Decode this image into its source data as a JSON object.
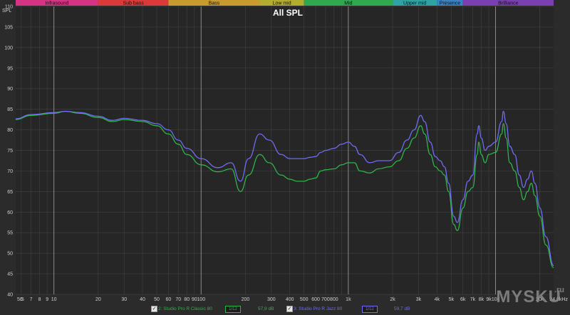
{
  "chart_data": {
    "type": "line",
    "title": "All SPL",
    "ylabel": "SPL",
    "xscale": "log",
    "xlim": [
      5.5,
      24800
    ],
    "ylim": [
      40,
      110
    ],
    "grid": true,
    "bands": [
      {
        "name": "Infrasound",
        "from": 5.5,
        "to": 20,
        "color": "#d63384"
      },
      {
        "name": "Sub bass",
        "from": 20,
        "to": 60,
        "color": "#dc3a3a"
      },
      {
        "name": "Bass",
        "from": 60,
        "to": 250,
        "color": "#c99a2e"
      },
      {
        "name": "Low mid",
        "from": 250,
        "to": 500,
        "color": "#b3ad2f"
      },
      {
        "name": "Mid",
        "from": 500,
        "to": 2000,
        "color": "#2fa84f"
      },
      {
        "name": "Upper mid",
        "from": 2000,
        "to": 4000,
        "color": "#2fa3a3"
      },
      {
        "name": "Presence",
        "from": 4000,
        "to": 6000,
        "color": "#3b82c4"
      },
      {
        "name": "Brilliance",
        "from": 6000,
        "to": 24800,
        "color": "#7a3fb0"
      }
    ],
    "y_ticks": [
      "40",
      "45",
      "50",
      "55",
      "60",
      "65",
      "70",
      "75",
      "80",
      "85",
      "90",
      "95",
      "100",
      "105",
      "110"
    ],
    "x_ticks": [
      {
        "v": 5.5,
        "l": "5.5"
      },
      {
        "v": 6,
        "l": "6"
      },
      {
        "v": 7,
        "l": "7"
      },
      {
        "v": 8,
        "l": "8"
      },
      {
        "v": 9,
        "l": "9"
      },
      {
        "v": 10,
        "l": "10"
      },
      {
        "v": 20,
        "l": "20"
      },
      {
        "v": 30,
        "l": "30"
      },
      {
        "v": 40,
        "l": "40"
      },
      {
        "v": 50,
        "l": "50"
      },
      {
        "v": 60,
        "l": "60"
      },
      {
        "v": 70,
        "l": "70"
      },
      {
        "v": 80,
        "l": "80"
      },
      {
        "v": 90,
        "l": "90"
      },
      {
        "v": 100,
        "l": "100"
      },
      {
        "v": 200,
        "l": "200"
      },
      {
        "v": 300,
        "l": "300"
      },
      {
        "v": 400,
        "l": "400"
      },
      {
        "v": 500,
        "l": "500"
      },
      {
        "v": 600,
        "l": "600"
      },
      {
        "v": 700,
        "l": "700"
      },
      {
        "v": 800,
        "l": "800"
      },
      {
        "v": 1000,
        "l": "1k"
      },
      {
        "v": 2000,
        "l": "2k"
      },
      {
        "v": 3000,
        "l": "3k"
      },
      {
        "v": 4000,
        "l": "4k"
      },
      {
        "v": 5000,
        "l": "5k"
      },
      {
        "v": 6000,
        "l": "6k"
      },
      {
        "v": 7000,
        "l": "7k"
      },
      {
        "v": 8000,
        "l": "8k"
      },
      {
        "v": 9000,
        "l": "9k"
      },
      {
        "v": 10000,
        "l": "10k"
      },
      {
        "v": 20000,
        "l": "20k"
      },
      {
        "v": 24800,
        "l": "24.8kHz"
      }
    ],
    "series": [
      {
        "name": "2: Studio Pro R Classic 80",
        "color": "#2fb34a",
        "points": [
          [
            5.5,
            82.5
          ],
          [
            7,
            83.5
          ],
          [
            10,
            84
          ],
          [
            12,
            84.5
          ],
          [
            15,
            84
          ],
          [
            20,
            83
          ],
          [
            25,
            82
          ],
          [
            30,
            82.5
          ],
          [
            40,
            82
          ],
          [
            50,
            81
          ],
          [
            60,
            79
          ],
          [
            70,
            76.5
          ],
          [
            80,
            74
          ],
          [
            100,
            71.5
          ],
          [
            130,
            69.8
          ],
          [
            160,
            70.5
          ],
          [
            185,
            65
          ],
          [
            210,
            69
          ],
          [
            250,
            74
          ],
          [
            290,
            72
          ],
          [
            350,
            69
          ],
          [
            400,
            68
          ],
          [
            450,
            67.5
          ],
          [
            500,
            67.5
          ],
          [
            550,
            68
          ],
          [
            600,
            68.3
          ],
          [
            650,
            70
          ],
          [
            700,
            70.3
          ],
          [
            800,
            70.5
          ],
          [
            900,
            71.5
          ],
          [
            1000,
            72
          ],
          [
            1100,
            72
          ],
          [
            1200,
            70
          ],
          [
            1400,
            69.5
          ],
          [
            1600,
            70.5
          ],
          [
            1900,
            71
          ],
          [
            2200,
            72.5
          ],
          [
            2500,
            75.5
          ],
          [
            2800,
            78
          ],
          [
            3100,
            81
          ],
          [
            3300,
            79
          ],
          [
            3600,
            74
          ],
          [
            3900,
            71
          ],
          [
            4200,
            70
          ],
          [
            4500,
            69
          ],
          [
            4800,
            65
          ],
          [
            5200,
            57
          ],
          [
            5500,
            55.5
          ],
          [
            6000,
            61
          ],
          [
            6500,
            65
          ],
          [
            7000,
            66
          ],
          [
            7500,
            74
          ],
          [
            7700,
            77
          ],
          [
            8000,
            74
          ],
          [
            8500,
            72
          ],
          [
            9000,
            74
          ],
          [
            10000,
            74.5
          ],
          [
            11000,
            79
          ],
          [
            11300,
            81.5
          ],
          [
            11800,
            78
          ],
          [
            12500,
            72
          ],
          [
            13500,
            70
          ],
          [
            14500,
            66
          ],
          [
            15500,
            63
          ],
          [
            16500,
            65
          ],
          [
            17500,
            67
          ],
          [
            18500,
            64
          ],
          [
            20000,
            59
          ],
          [
            22000,
            52
          ],
          [
            24800,
            46.5
          ]
        ]
      },
      {
        "name": "3: Studio Pro R Jazz 80",
        "color": "#6f6cf2",
        "points": [
          [
            5.5,
            82.7
          ],
          [
            7,
            83.7
          ],
          [
            10,
            84.2
          ],
          [
            12,
            84.5
          ],
          [
            15,
            84.2
          ],
          [
            20,
            83.3
          ],
          [
            25,
            82.3
          ],
          [
            30,
            82.8
          ],
          [
            40,
            82.3
          ],
          [
            50,
            81.5
          ],
          [
            60,
            80
          ],
          [
            70,
            77.5
          ],
          [
            80,
            75.5
          ],
          [
            100,
            73
          ],
          [
            130,
            70.8
          ],
          [
            160,
            72
          ],
          [
            185,
            67.5
          ],
          [
            210,
            73
          ],
          [
            250,
            79
          ],
          [
            290,
            77.5
          ],
          [
            350,
            74
          ],
          [
            400,
            73
          ],
          [
            450,
            73
          ],
          [
            500,
            73
          ],
          [
            550,
            73.3
          ],
          [
            600,
            73.5
          ],
          [
            650,
            74.5
          ],
          [
            700,
            75
          ],
          [
            800,
            75.5
          ],
          [
            900,
            76.5
          ],
          [
            1000,
            77
          ],
          [
            1100,
            76
          ],
          [
            1200,
            74
          ],
          [
            1400,
            72
          ],
          [
            1600,
            72.5
          ],
          [
            1900,
            72.5
          ],
          [
            2200,
            74.5
          ],
          [
            2500,
            77.5
          ],
          [
            2800,
            80
          ],
          [
            3100,
            83.5
          ],
          [
            3300,
            82
          ],
          [
            3600,
            77
          ],
          [
            3900,
            73.5
          ],
          [
            4200,
            72.5
          ],
          [
            4500,
            71
          ],
          [
            4800,
            67
          ],
          [
            5200,
            59
          ],
          [
            5500,
            57.5
          ],
          [
            6000,
            63
          ],
          [
            6500,
            67.5
          ],
          [
            7000,
            69
          ],
          [
            7500,
            79
          ],
          [
            7700,
            81
          ],
          [
            8000,
            78
          ],
          [
            8500,
            75
          ],
          [
            9000,
            76
          ],
          [
            10000,
            77
          ],
          [
            11000,
            82
          ],
          [
            11300,
            84.5
          ],
          [
            11800,
            81.5
          ],
          [
            12500,
            76
          ],
          [
            13500,
            74
          ],
          [
            14500,
            69
          ],
          [
            15500,
            66
          ],
          [
            16500,
            68
          ],
          [
            17500,
            70
          ],
          [
            18500,
            67
          ],
          [
            20000,
            61
          ],
          [
            22000,
            54
          ],
          [
            24800,
            47
          ]
        ]
      }
    ]
  },
  "legend": [
    {
      "check": "✓",
      "name": "2: Studio Pro R Classic 80",
      "smoothing": "1/12",
      "value": "57,9 dB",
      "color": "#2fb34a"
    },
    {
      "check": "✓",
      "name": "3: Studio Pro R Jazz 80",
      "smoothing": "1/12",
      "value": "59,7 dB",
      "color": "#6f6cf2"
    }
  ],
  "watermark": {
    "text": "MYSKU",
    "suffix": ".ru"
  }
}
